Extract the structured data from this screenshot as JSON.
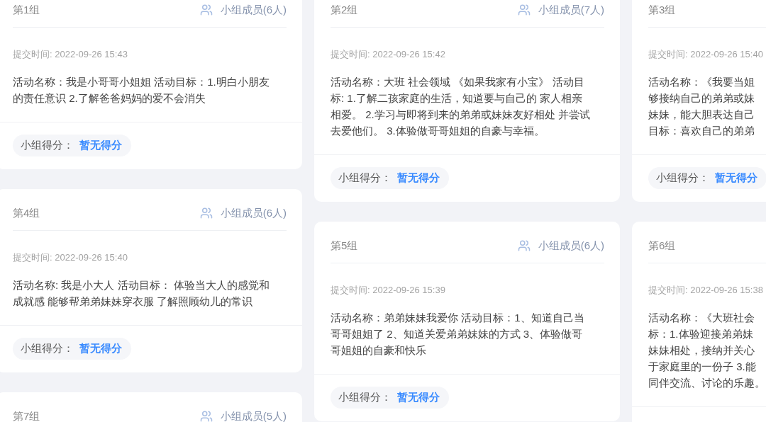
{
  "columns": [
    {
      "cards": [
        {
          "title": "第1组",
          "members": "小组成员(6人)",
          "submitted": "提交时间: 2022-09-26 15:43",
          "description": [
            "活动名称：我是小哥哥小姐姐 活动目标：1.明白小朋友",
            "的责任意识 2.了解爸爸妈妈的爱不会消失"
          ],
          "score": {
            "label": "小组得分：",
            "value": "暂无得分"
          }
        },
        {
          "title": "第4组",
          "members": "小组成员(6人)",
          "submitted": "提交时间: 2022-09-26 15:40",
          "description": [
            "活动名称: 我是小大人 活动目标： 体验当大人的感觉和",
            "成就感 能够帮弟弟妹妹穿衣服 了解照顾幼儿的常识"
          ],
          "score": {
            "label": "小组得分：",
            "value": "暂无得分"
          }
        },
        {
          "title": "第7组",
          "members": "小组成员(5人)"
        }
      ]
    },
    {
      "cards": [
        {
          "title": "第2组",
          "members": "小组成员(7人)",
          "submitted": "提交时间: 2022-09-26 15:42",
          "description": [
            "活动名称：大班 社会领域 《如果我家有小宝》 活动目",
            "标: 1.了解二孩家庭的生活，知道要与自己的 家人相亲",
            "相爱。 2.学习与即将到来的弟弟或妹妹友好相处 并尝试",
            "去爱他们。 3.体验做哥哥姐姐的自豪与幸福。"
          ],
          "score": {
            "label": "小组得分：",
            "value": "暂无得分"
          }
        },
        {
          "title": "第5组",
          "members": "小组成员(6人)",
          "submitted": "提交时间: 2022-09-26 15:39",
          "description": [
            "活动名称：弟弟妹妹我爱你 活动目标：1、知道自己当",
            "哥哥姐姐了 2、知道关爱弟弟妹妹的方式 3、体验做哥",
            "哥姐姐的自豪和快乐"
          ],
          "score": {
            "label": "小组得分：",
            "value": "暂无得分"
          }
        }
      ]
    },
    {
      "cards": [
        {
          "title": "第3组",
          "submitted": "提交时间: 2022-09-26 15:40",
          "description": [
            "活动名称：《我要当姐",
            "够接纳自己的弟弟或妹",
            "妹妹，能大胆表达自己",
            "目标：喜欢自己的弟弟"
          ],
          "score": {
            "label": "小组得分：",
            "value": "暂无得分"
          }
        },
        {
          "title": "第6组",
          "submitted": "提交时间: 2022-09-26 15:38",
          "description": [
            "活动名称：《大班社会",
            "标：1.体验迎接弟弟妹",
            "妹妹相处，接纳并关心",
            "于家庭里的一份子 3.能",
            "同伴交流、讨论的乐趣。"
          ]
        }
      ]
    }
  ]
}
